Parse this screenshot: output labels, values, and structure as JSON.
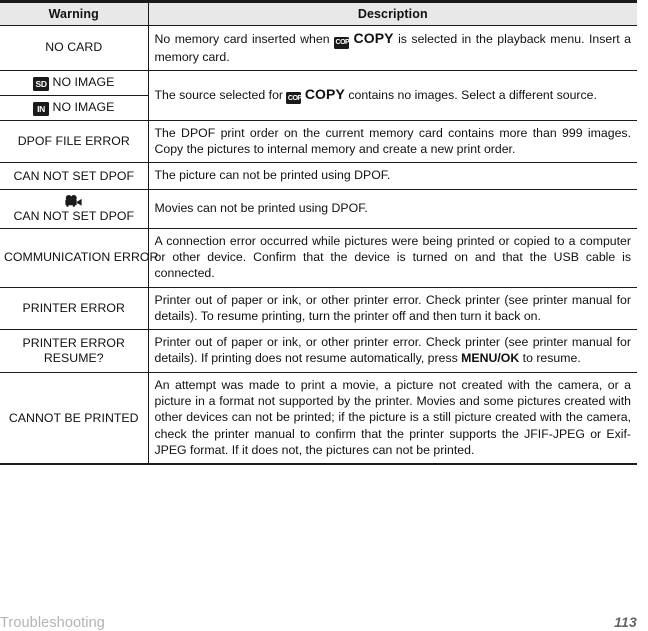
{
  "table": {
    "headers": {
      "warning": "Warning",
      "description": "Description"
    },
    "rows": [
      {
        "warning": "NO CARD",
        "warning_icon": "",
        "desc_pre": "No memory card inserted when ",
        "desc_icon": "copy-badge-icon",
        "desc_copy_word": "COPY",
        "desc_post": " is selected in the playback menu.  Insert a memory card."
      },
      {
        "warning": "NO IMAGE",
        "warning_icon": "sd-card-icon",
        "desc_pre": "The source selected for ",
        "desc_icon": "copy-badge-icon",
        "desc_copy_word": "COPY",
        "desc_post": " contains no images.  Select a different source."
      },
      {
        "warning": "NO IMAGE",
        "warning_icon": "internal-memory-icon",
        "desc_pre": "",
        "desc_icon": "",
        "desc_copy_word": "",
        "desc_post": ""
      },
      {
        "warning": "DPOF FILE ERROR",
        "warning_icon": "",
        "desc_pre": "The DPOF print order on the current memory card contains more than 999 images.  Copy the pictures to internal memory and create a new print order.",
        "desc_icon": "",
        "desc_copy_word": "",
        "desc_post": ""
      },
      {
        "warning": "CAN NOT SET DPOF",
        "warning_icon": "",
        "desc_pre": "The picture can not be printed using DPOF.",
        "desc_icon": "",
        "desc_copy_word": "",
        "desc_post": ""
      },
      {
        "warning": "CAN NOT SET DPOF",
        "warning_icon": "movie-camera-icon",
        "desc_pre": "Movies can not be printed using DPOF.",
        "desc_icon": "",
        "desc_copy_word": "",
        "desc_post": ""
      },
      {
        "warning": "COMMUNICATION ERROR",
        "warning_icon": "",
        "desc_pre": "A connection error occurred while pictures were being printed or copied to a computer or other device.  Confirm that the device is turned on and that the USB cable is connected.",
        "desc_icon": "",
        "desc_copy_word": "",
        "desc_post": ""
      },
      {
        "warning": "PRINTER ERROR",
        "warning_icon": "",
        "desc_pre": "Printer out of paper or ink, or other printer error.  Check printer (see printer manual for details).  To resume printing, turn the printer off and then turn it back on.",
        "desc_icon": "",
        "desc_copy_word": "",
        "desc_post": ""
      },
      {
        "warning": "PRINTER ERROR RESUME?",
        "warning_line1": "PRINTER ERROR",
        "warning_line2": "RESUME?",
        "warning_icon": "",
        "desc_pre": "Printer out of paper or ink, or other printer error.  Check printer (see printer manual for details).  If printing does not resume automatically, press ",
        "desc_bold": "MENU/OK",
        "desc_post": " to resume."
      },
      {
        "warning": "CANNOT BE PRINTED",
        "warning_icon": "",
        "desc_pre": "An attempt was made to print a movie, a picture not created with the camera, or a picture in a format not supported by the printer.  Movies and some pictures created with other devices can not be printed; if the picture is a still picture created with the camera, check the printer manual to confirm that the printer supports the JFIF-JPEG or Exif-JPEG format.  If it does not, the pictures can not be printed.",
        "desc_icon": "",
        "desc_copy_word": "",
        "desc_post": ""
      }
    ],
    "icon_labels": {
      "sd": "SD",
      "internal": "IN",
      "copy": "COPY"
    }
  },
  "footer": {
    "section": "Troubleshooting",
    "page_number": "113"
  },
  "colors": {
    "header_background": "#e8e8e8",
    "border": "#1a1a1a",
    "text": "#111111",
    "footer_section": "#b3b3b3",
    "footer_page": "#666666"
  }
}
